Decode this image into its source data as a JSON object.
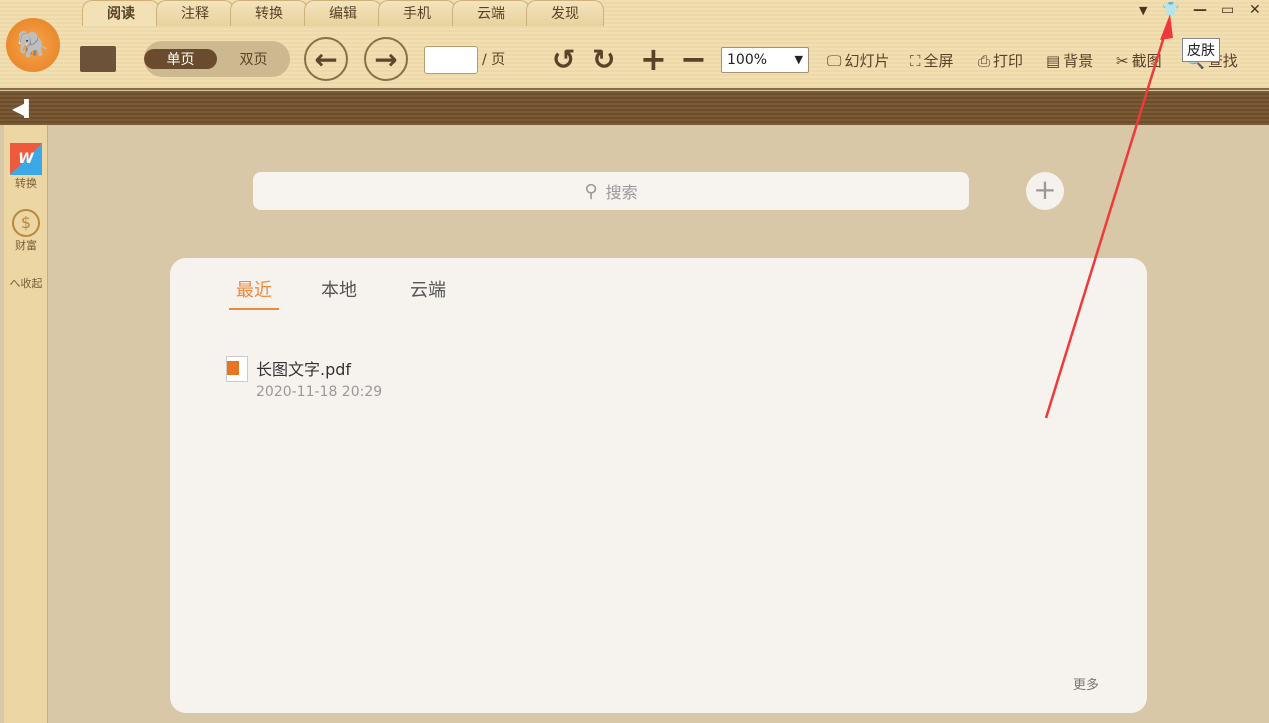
{
  "menu_tabs": [
    "阅读",
    "注释",
    "转换",
    "编辑",
    "手机",
    "云端",
    "发现"
  ],
  "view": {
    "single": "单页",
    "double": "双页"
  },
  "page": {
    "value": "",
    "suffix": "/ 页"
  },
  "zoom": "100%",
  "tools": [
    "幻灯片",
    "全屏",
    "打印",
    "背景",
    "截图",
    "查找"
  ],
  "tooltip": "皮肤",
  "sidebar": {
    "convert": "转换",
    "wealth": "财富",
    "collapse": "へ收起"
  },
  "search": {
    "placeholder": "搜索"
  },
  "card": {
    "tabs": [
      "最近",
      "本地",
      "云端"
    ],
    "files": [
      {
        "name": "长图文字.pdf",
        "date": "2020-11-18 20:29"
      }
    ],
    "more": "更多"
  },
  "annotation_color": "#f03a3a"
}
